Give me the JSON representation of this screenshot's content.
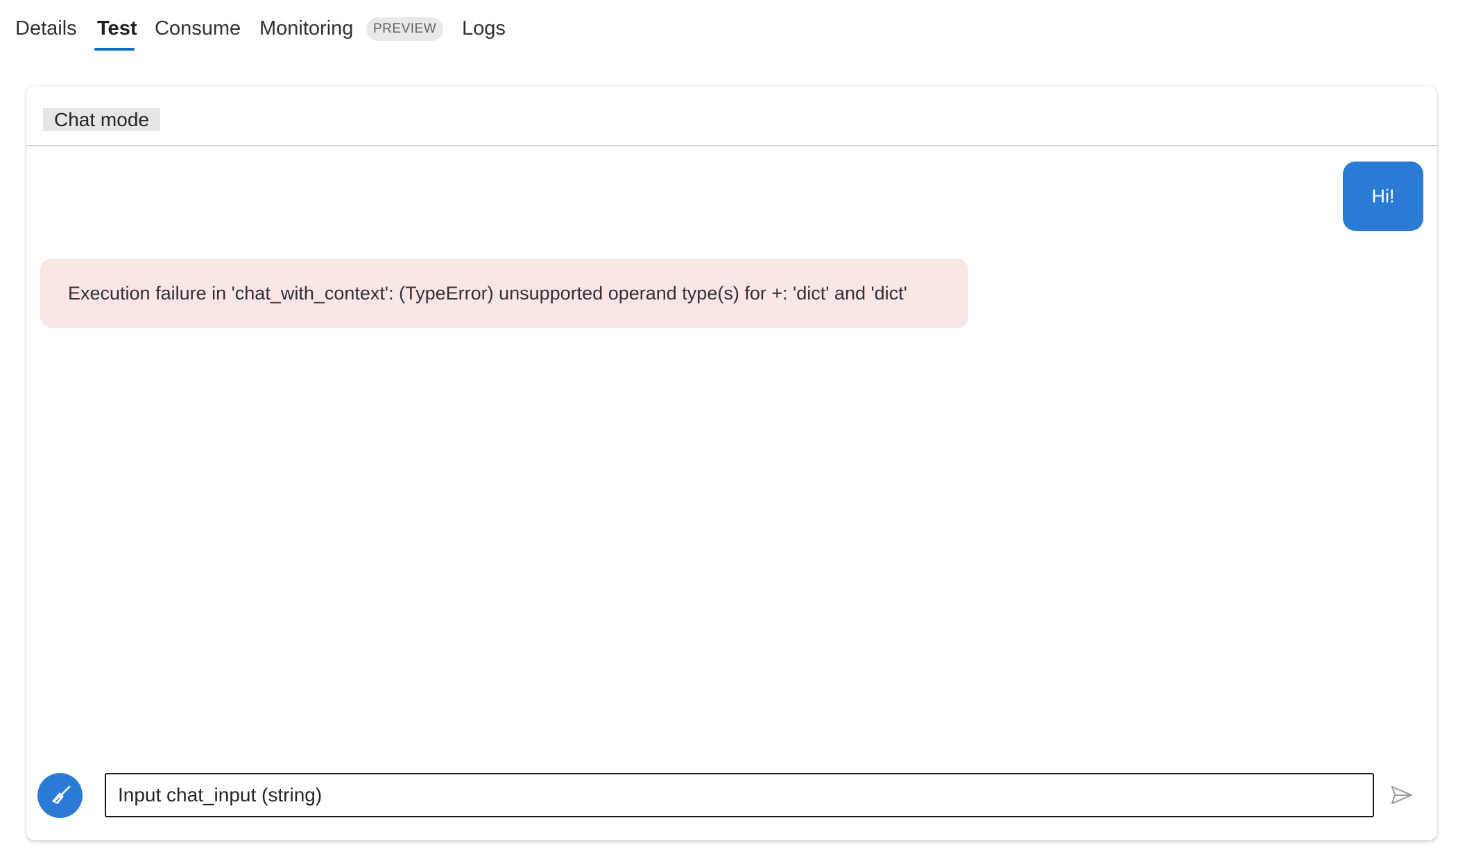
{
  "tabs": [
    {
      "label": "Details"
    },
    {
      "label": "Test",
      "active": true
    },
    {
      "label": "Consume"
    },
    {
      "label": "Monitoring",
      "badge": "PREVIEW"
    },
    {
      "label": "Logs"
    }
  ],
  "chat": {
    "mode_label": "Chat mode",
    "messages": [
      {
        "role": "user",
        "text": "Hi!"
      },
      {
        "role": "error",
        "text": "Execution failure in 'chat_with_context': (TypeError) unsupported operand type(s) for +: 'dict' and 'dict'"
      }
    ],
    "input": {
      "value": "",
      "placeholder": "Input chat_input (string)"
    },
    "clear_icon": "broom-icon",
    "send_icon": "send-icon"
  },
  "colors": {
    "accent": "#2b7bd6",
    "tab_underline": "#0f6cbd",
    "error_bg": "#fbe6e6"
  }
}
